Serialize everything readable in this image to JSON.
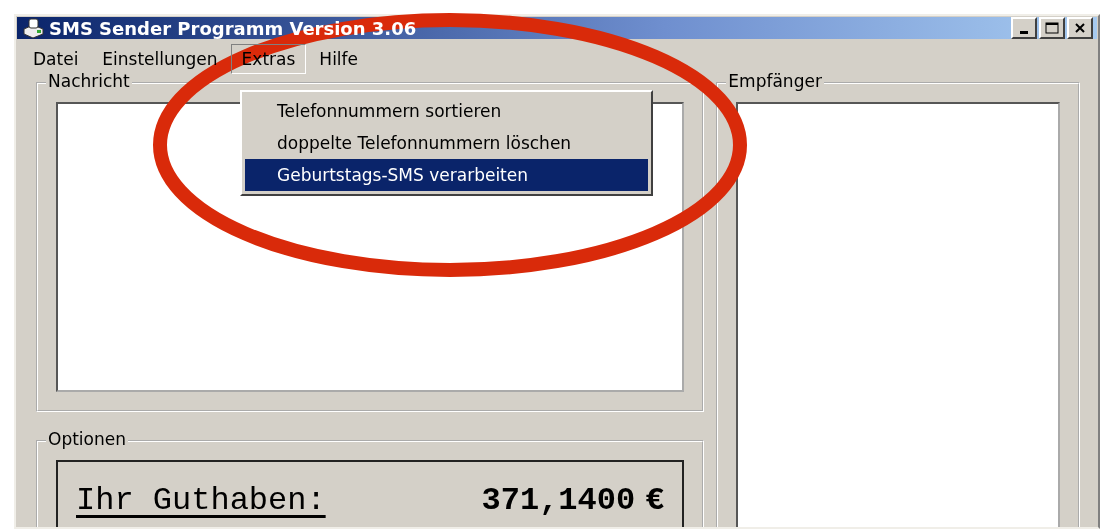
{
  "window": {
    "title": "SMS Sender Programm Version 3.06"
  },
  "menu": [
    {
      "label": "Datei",
      "open": false
    },
    {
      "label": "Einstellungen",
      "open": false
    },
    {
      "label": "Extras",
      "open": true
    },
    {
      "label": "Hilfe",
      "open": false
    }
  ],
  "extras_menu": {
    "items": [
      {
        "label": "Telefonnummern sortieren",
        "selected": false
      },
      {
        "label": "doppelte Telefonnummern löschen",
        "selected": false
      },
      {
        "label": "Geburtstags-SMS verarbeiten",
        "selected": true
      }
    ]
  },
  "message_group": {
    "label": "Nachricht"
  },
  "recipients_group": {
    "label": "Empfänger"
  },
  "options_group": {
    "label": "Optionen",
    "balance_label": "Ihr Guthaben:",
    "balance_value": "371,1400",
    "currency": "€"
  }
}
